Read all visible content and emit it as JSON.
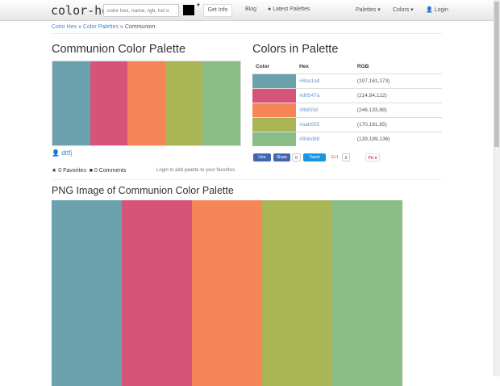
{
  "nav": {
    "brand": "color-hex",
    "search_placeholder": "color hex, name, rgb, hsl o",
    "get_info": "Get Info",
    "blog": "Blog",
    "latest": "Latest Palettes",
    "palettes": "Palettes ▾",
    "colors": "Colors ▾",
    "login": "Login"
  },
  "breadcrumb": {
    "home": "Color Hex",
    "palettes": "Color Palettes",
    "current": "Communion"
  },
  "title": "Communion Color Palette",
  "table": {
    "title": "Colors in Palette",
    "headers": [
      "Color",
      "Hex",
      "RGB"
    ],
    "rows": [
      {
        "hex": "#6ba1ad",
        "rgb": "(107,161,173)"
      },
      {
        "hex": "#d6547a",
        "rgb": "(214,84,122)"
      },
      {
        "hex": "#f68558",
        "rgb": "(246,133,88)"
      },
      {
        "hex": "#aab555",
        "rgb": "(170,181,85)"
      },
      {
        "hex": "#8bbd88",
        "rgb": "(139,189,136)"
      }
    ]
  },
  "social": {
    "like": "Like",
    "share": "Share",
    "share_count": "0",
    "tweet": "Tweet",
    "gplus": "G+1",
    "gplus_count": "0",
    "pinit": "Pin it"
  },
  "author": "dttfj",
  "favorites": "0 Favorites",
  "comments": "0 Comments",
  "login_note": "Login to add palette to your favorites.",
  "png_title": "PNG Image of Communion Color Palette"
}
